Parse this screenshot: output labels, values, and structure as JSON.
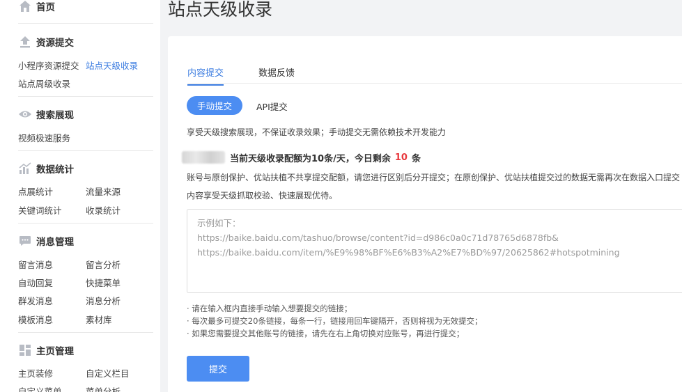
{
  "sidebar": {
    "home": "首页",
    "sections": [
      {
        "title": "资源提交",
        "items": [
          "小程序资源提交",
          "站点天级收录",
          "站点周级收录"
        ]
      },
      {
        "title": "搜索展现",
        "items": [
          "视频极速服务"
        ]
      },
      {
        "title": "数据统计",
        "items": [
          "点展统计",
          "流量来源",
          "关键词统计",
          "收录统计"
        ]
      },
      {
        "title": "消息管理",
        "items": [
          "留言消息",
          "留言分析",
          "自动回复",
          "快捷菜单",
          "群发消息",
          "消息分析",
          "模板消息",
          "素材库"
        ]
      },
      {
        "title": "主页管理",
        "items": [
          "主页装修",
          "自定义栏目",
          "自定义菜单",
          "菜单分析"
        ]
      }
    ]
  },
  "main": {
    "title": "站点天级收录",
    "tabs": [
      "内容提交",
      "数据反馈"
    ],
    "mode_buttons": [
      "手动提交",
      "API提交"
    ],
    "description": "享受天级搜索展现，不保证收录效果；手动提交无需依赖技术开发能力",
    "quota": {
      "prefix": "当前天级收录配额为10条/天，今日剩余",
      "remaining": "10",
      "suffix": "条"
    },
    "notice": {
      "line1": "账号与原创保护、优站扶植不共享提交配额，请您进行区别后分开提交；在原创保护、优站扶植提交过的数据无需再次在数据入口提交",
      "line2": "内容享受天级抓取校验、快速展现优待。"
    },
    "textarea": {
      "label": "示例如下：",
      "example1": "https://baike.baidu.com/tashuo/browse/content?id=d986c0a0c71d78765d6878fb&",
      "example2": "https://baike.baidu.com/item/%E9%98%BF%E6%B3%A2%E7%BD%97/20625862#hotspotmining"
    },
    "tips": [
      "· 请在输入框内直接手动输入想要提交的链接；",
      "· 每次最多可提交20条链接，每条一行，链接用回车键隔开，否则将视为无效提交；",
      "· 如果您需要提交其他账号的链接，请先在右上角切换对应账号，再进行提交；"
    ],
    "submit_label": "提交"
  },
  "colors": {
    "accent": "#4c8df2",
    "link": "#3a7be0",
    "highlight": "#e8383d"
  }
}
